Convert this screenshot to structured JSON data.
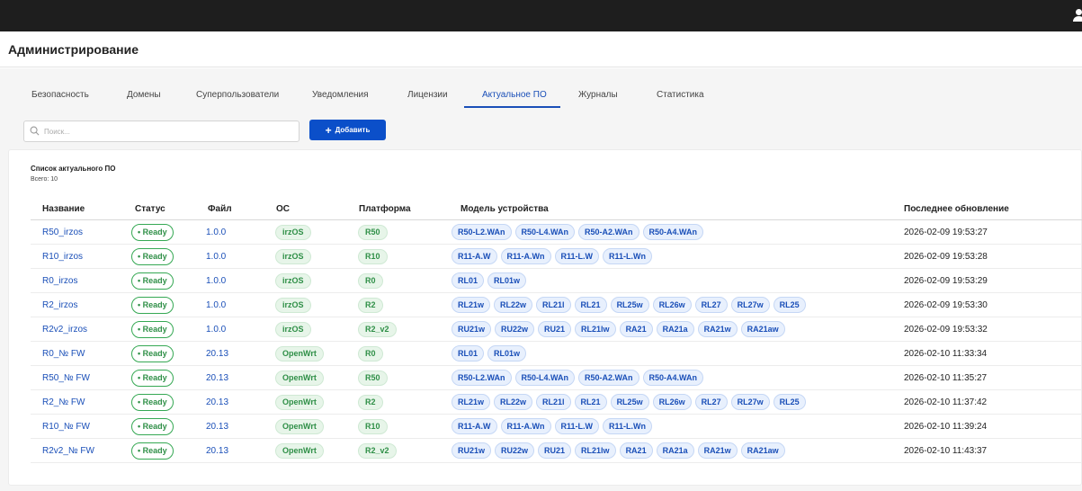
{
  "header": {
    "title": "Администрирование"
  },
  "tabs": [
    {
      "label": "Безопасность",
      "active": false
    },
    {
      "label": "Домены",
      "active": false
    },
    {
      "label": "Суперпользователи",
      "active": false
    },
    {
      "label": "Уведомления",
      "active": false
    },
    {
      "label": "Лицензии",
      "active": false
    },
    {
      "label": "Актуальное ПО",
      "active": true
    },
    {
      "label": "Журналы",
      "active": false
    },
    {
      "label": "Статистика",
      "active": false
    }
  ],
  "search": {
    "placeholder": "Поиск..."
  },
  "add_button": {
    "label": "Добавить",
    "icon": "plus-icon"
  },
  "list": {
    "title": "Список актуального ПО",
    "count": "Всего: 10"
  },
  "columns": [
    "Название",
    "Статус",
    "Файл",
    "ОС",
    "Платформа",
    "Модель устройства",
    "Последнее обновление"
  ],
  "rows": [
    {
      "name": "R50_irzos",
      "status": "• Ready",
      "file": "1.0.0",
      "os": "irzOS",
      "platform": "R50",
      "models": [
        "R50-L2.WAn",
        "R50-L4.WAn",
        "R50-A2.WAn",
        "R50-A4.WAn"
      ],
      "updated": "2026-02-09 19:53:27"
    },
    {
      "name": "R10_irzos",
      "status": "• Ready",
      "file": "1.0.0",
      "os": "irzOS",
      "platform": "R10",
      "models": [
        "R11-A.W",
        "R11-A.Wn",
        "R11-L.W",
        "R11-L.Wn"
      ],
      "updated": "2026-02-09 19:53:28"
    },
    {
      "name": "R0_irzos",
      "status": "• Ready",
      "file": "1.0.0",
      "os": "irzOS",
      "platform": "R0",
      "models": [
        "RL01",
        "RL01w"
      ],
      "updated": "2026-02-09 19:53:29"
    },
    {
      "name": "R2_irzos",
      "status": "• Ready",
      "file": "1.0.0",
      "os": "irzOS",
      "platform": "R2",
      "models": [
        "RL21w",
        "RL22w",
        "RL21l",
        "RL21",
        "RL25w",
        "RL26w",
        "RL27",
        "RL27w",
        "RL25"
      ],
      "updated": "2026-02-09 19:53:30"
    },
    {
      "name": "R2v2_irzos",
      "status": "• Ready",
      "file": "1.0.0",
      "os": "irzOS",
      "platform": "R2_v2",
      "models": [
        "RU21w",
        "RU22w",
        "RU21",
        "RL21lw",
        "RA21",
        "RA21a",
        "RA21w",
        "RA21aw"
      ],
      "updated": "2026-02-09 19:53:32"
    },
    {
      "name": "R0_№ FW",
      "status": "• Ready",
      "file": "20.13",
      "os": "OpenWrt",
      "platform": "R0",
      "models": [
        "RL01",
        "RL01w"
      ],
      "updated": "2026-02-10 11:33:34"
    },
    {
      "name": "R50_№ FW",
      "status": "• Ready",
      "file": "20.13",
      "os": "OpenWrt",
      "platform": "R50",
      "models": [
        "R50-L2.WAn",
        "R50-L4.WAn",
        "R50-A2.WAn",
        "R50-A4.WAn"
      ],
      "updated": "2026-02-10 11:35:27"
    },
    {
      "name": "R2_№ FW",
      "status": "• Ready",
      "file": "20.13",
      "os": "OpenWrt",
      "platform": "R2",
      "models": [
        "RL21w",
        "RL22w",
        "RL21l",
        "RL21",
        "RL25w",
        "RL26w",
        "RL27",
        "RL27w",
        "RL25"
      ],
      "updated": "2026-02-10 11:37:42"
    },
    {
      "name": "R10_№ FW",
      "status": "• Ready",
      "file": "20.13",
      "os": "OpenWrt",
      "platform": "R10",
      "models": [
        "R11-A.W",
        "R11-A.Wn",
        "R11-L.W",
        "R11-L.Wn"
      ],
      "updated": "2026-02-10 11:39:24"
    },
    {
      "name": "R2v2_№ FW",
      "status": "• Ready",
      "file": "20.13",
      "os": "OpenWrt",
      "platform": "R2_v2",
      "models": [
        "RU21w",
        "RU22w",
        "RU21",
        "RL21lw",
        "RA21",
        "RA21a",
        "RA21w",
        "RA21aw"
      ],
      "updated": "2026-02-10 11:43:37"
    }
  ],
  "colors": {
    "accent": "#1a4fb8",
    "button": "#0b4fc9",
    "ready": "#2f8f47",
    "topbar": "#1e1e1e"
  },
  "icons": {
    "user": "user-icon",
    "search": "search-icon",
    "plus": "plus-icon"
  }
}
